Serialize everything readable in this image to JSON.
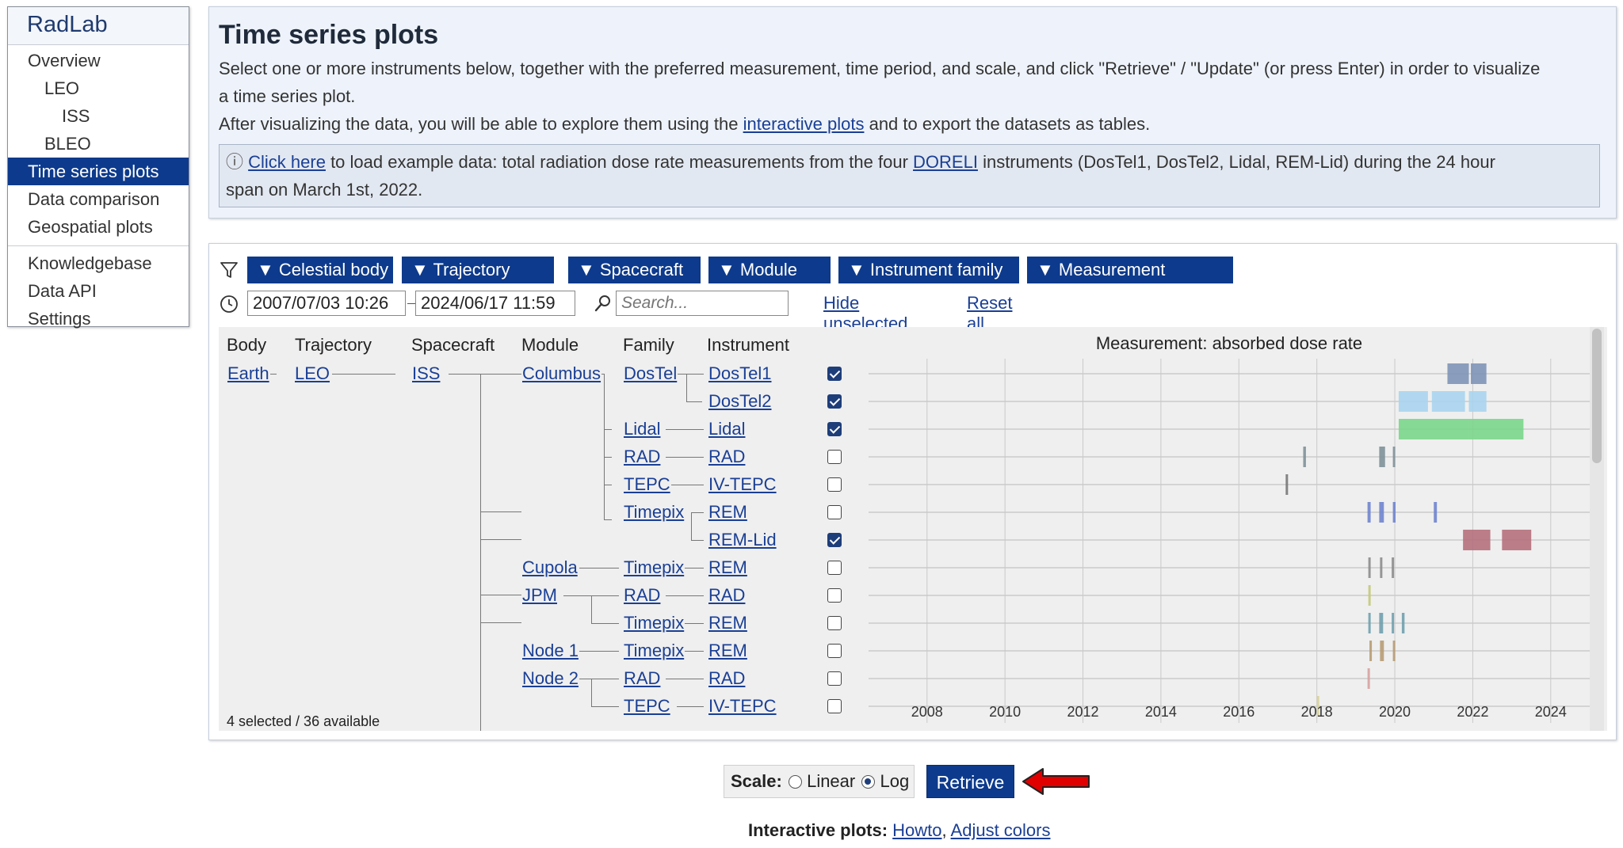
{
  "sidebar": {
    "brand": "RadLab",
    "items": [
      {
        "label": "Overview"
      },
      {
        "label": "LEO"
      },
      {
        "label": "ISS"
      },
      {
        "label": "BLEO"
      },
      {
        "label": "Time series plots"
      },
      {
        "label": "Data comparison"
      },
      {
        "label": "Geospatial plots"
      },
      {
        "label": "Knowledgebase"
      },
      {
        "label": "Data API"
      },
      {
        "label": "Settings"
      }
    ]
  },
  "intro": {
    "title": "Time series plots",
    "line1": "Select one or more instruments below, together with the preferred measurement, time period, and scale, and click \"Retrieve\" / \"Update\" (or press Enter) in order to visualize",
    "line2": "a time series plot.",
    "line3_before": "After visualizing the data, you will be able to explore them using the ",
    "line3_link": "interactive plots",
    "line3_after": " and to export the datasets as tables.",
    "info_icon": "ⓘ",
    "info_link": "Click here",
    "info_mid": " to load example data: total radiation dose rate measurements from the four ",
    "info_link2": "DORELI",
    "info_after": " instruments (DosTel1, DosTel2, Lidal, REM-Lid) during the 24 hour",
    "info_line2": "span on March 1st, 2022."
  },
  "filters": {
    "buttons": [
      "▼ Celestial body",
      "▼ Trajectory",
      "▼ Spacecraft",
      "▼ Module",
      "▼ Instrument family",
      "▼ Measurement"
    ],
    "date_from": "2007/07/03 10:26",
    "date_to": "2024/06/17 11:59",
    "search_placeholder": "Search...",
    "hide_unselected": "Hide unselected",
    "reset_filters": "Reset all filters"
  },
  "table": {
    "headers": {
      "body": "Body",
      "trajectory": "Trajectory",
      "spacecraft": "Spacecraft",
      "module": "Module",
      "family": "Family",
      "instrument": "Instrument"
    },
    "body": "Earth",
    "trajectory": "LEO",
    "spacecraft": "ISS",
    "modules": [
      "Columbus",
      "Cupola",
      "JPM",
      "Node 1",
      "Node 2"
    ],
    "families": [
      "DosTel",
      "Lidal",
      "RAD",
      "TEPC",
      "Timepix",
      "Timepix",
      "RAD",
      "Timepix",
      "Timepix",
      "RAD",
      "TEPC"
    ],
    "rows": [
      {
        "instrument": "DosTel1",
        "checked": true
      },
      {
        "instrument": "DosTel2",
        "checked": true
      },
      {
        "instrument": "Lidal",
        "checked": true
      },
      {
        "instrument": "RAD",
        "checked": false
      },
      {
        "instrument": "IV-TEPC",
        "checked": false
      },
      {
        "instrument": "REM",
        "checked": false
      },
      {
        "instrument": "REM-Lid",
        "checked": true
      },
      {
        "instrument": "REM",
        "checked": false
      },
      {
        "instrument": "RAD",
        "checked": false
      },
      {
        "instrument": "REM",
        "checked": false
      },
      {
        "instrument": "REM",
        "checked": false
      },
      {
        "instrument": "RAD",
        "checked": false
      },
      {
        "instrument": "IV-TEPC",
        "checked": false
      }
    ],
    "count": "4 selected / 36 available"
  },
  "chart_data": {
    "type": "timeline",
    "title": "Measurement: absorbed dose rate",
    "xlim": [
      2006.5,
      2025
    ],
    "xticks": [
      2008,
      2010,
      2012,
      2014,
      2016,
      2018,
      2020,
      2022,
      2024
    ],
    "series": [
      {
        "row": 0,
        "color": "#7f93b6",
        "spans": [
          [
            2021.35,
            2021.9
          ],
          [
            2021.95,
            2022.35
          ]
        ]
      },
      {
        "row": 1,
        "color": "#a9d4ee",
        "spans": [
          [
            2020.1,
            2020.85
          ],
          [
            2020.95,
            2021.8
          ],
          [
            2021.9,
            2022.35
          ]
        ]
      },
      {
        "row": 2,
        "color": "#7ad68a",
        "spans": [
          [
            2020.1,
            2021.9
          ],
          [
            2021.9,
            2023.3
          ]
        ]
      },
      {
        "row": 3,
        "color": "#7e9198",
        "spans": [
          [
            2017.65,
            2017.72
          ],
          [
            2019.6,
            2019.75
          ],
          [
            2019.95,
            2020.0
          ]
        ]
      },
      {
        "row": 4,
        "color": "#777777",
        "spans": [
          [
            2017.2,
            2017.25
          ]
        ]
      },
      {
        "row": 5,
        "color": "#6f84cf",
        "spans": [
          [
            2019.3,
            2019.38
          ],
          [
            2019.6,
            2019.72
          ],
          [
            2019.95,
            2020.02
          ],
          [
            2021.0,
            2021.08
          ]
        ]
      },
      {
        "row": 6,
        "color": "#b5707c",
        "spans": [
          [
            2021.75,
            2022.45
          ],
          [
            2022.75,
            2023.5
          ]
        ]
      },
      {
        "row": 7,
        "color": "#8c8c8c",
        "spans": [
          [
            2019.32,
            2019.38
          ],
          [
            2019.62,
            2019.68
          ],
          [
            2019.92,
            2019.98
          ]
        ]
      },
      {
        "row": 8,
        "color": "#c3c97a",
        "spans": [
          [
            2019.32,
            2019.38
          ]
        ]
      },
      {
        "row": 9,
        "color": "#6fa0ad",
        "spans": [
          [
            2019.32,
            2019.38
          ],
          [
            2019.6,
            2019.7
          ],
          [
            2019.92,
            2019.98
          ],
          [
            2020.18,
            2020.25
          ]
        ]
      },
      {
        "row": 10,
        "color": "#b79b73",
        "spans": [
          [
            2019.35,
            2019.4
          ],
          [
            2019.62,
            2019.72
          ],
          [
            2019.95,
            2020.0
          ]
        ]
      },
      {
        "row": 11,
        "color": "#d8a0a0",
        "spans": [
          [
            2019.3,
            2019.33
          ]
        ]
      },
      {
        "row": 12,
        "color": "#d7d29a",
        "spans": [
          [
            2018.0,
            2018.04
          ]
        ]
      }
    ]
  },
  "bottom": {
    "scale_label": "Scale:",
    "linear": "Linear",
    "log": "Log",
    "selected_scale": "Log",
    "retrieve": "Retrieve",
    "interactive_label": "Interactive plots:",
    "howto": "Howto",
    "adjust_colors": "Adjust colors"
  }
}
